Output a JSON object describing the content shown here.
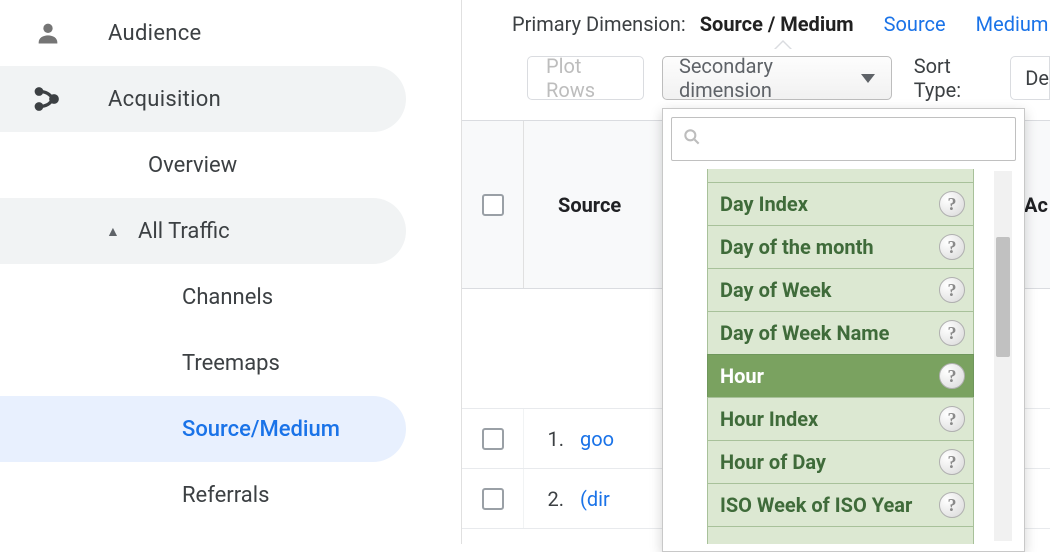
{
  "sidebar": {
    "audience": "Audience",
    "acquisition": "Acquisition",
    "overview": "Overview",
    "all_traffic": "All Traffic",
    "channels": "Channels",
    "treemaps": "Treemaps",
    "source_medium": "Source/Medium",
    "referrals": "Referrals"
  },
  "dim": {
    "label": "Primary Dimension:",
    "primary": "Source / Medium",
    "link_source": "Source",
    "link_medium": "Medium"
  },
  "toolbar": {
    "plot_rows": "Plot Rows",
    "secondary_dimension": "Secondary dimension",
    "sort_type": "Sort Type:",
    "sort_type_value_partial": "De"
  },
  "table": {
    "col_source": "Source",
    "col_acq_partial": "Ac",
    "rows": [
      {
        "idx": "1.",
        "value": "goo"
      },
      {
        "idx": "2.",
        "value": "(dir"
      }
    ]
  },
  "dropdown": {
    "search_placeholder": "",
    "items": [
      {
        "label": "",
        "partial": "top"
      },
      {
        "label": "Day Index"
      },
      {
        "label": "Day of the month"
      },
      {
        "label": "Day of Week"
      },
      {
        "label": "Day of Week Name"
      },
      {
        "label": "Hour",
        "hover": true
      },
      {
        "label": "Hour Index"
      },
      {
        "label": "Hour of Day"
      },
      {
        "label": "ISO Week of ISO Year"
      },
      {
        "label": "",
        "partial": "bottom"
      }
    ]
  }
}
